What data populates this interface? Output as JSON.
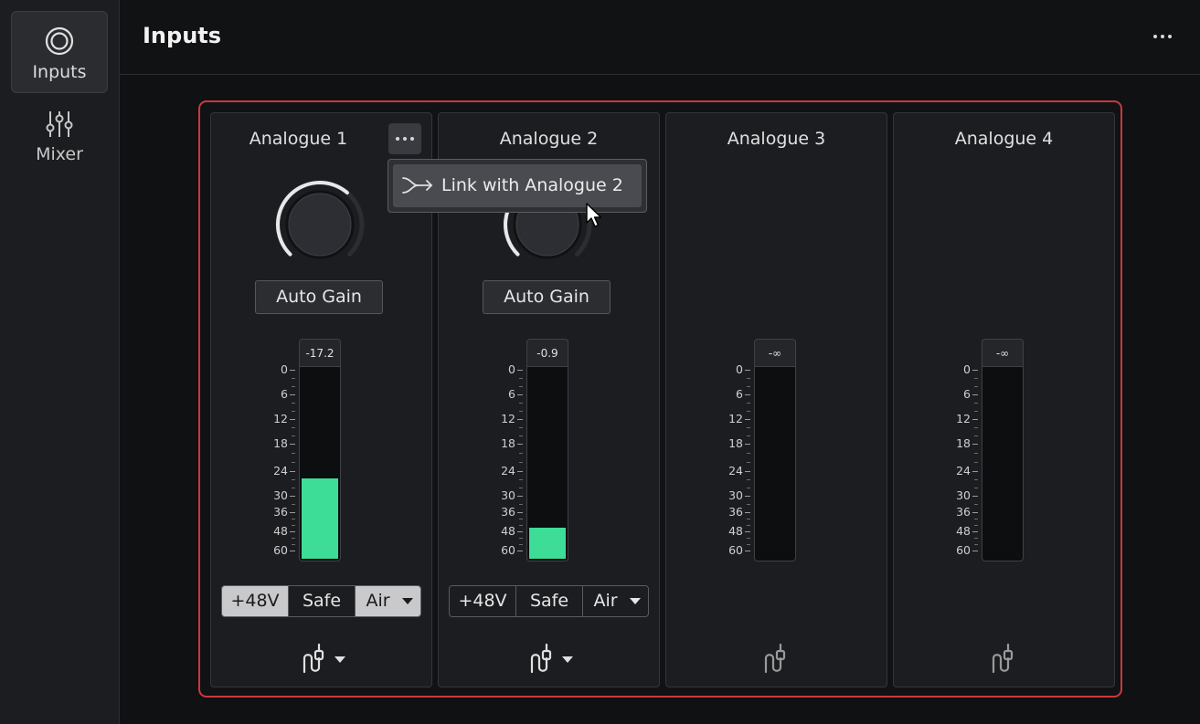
{
  "sidebar": {
    "items": [
      {
        "label": "Inputs",
        "icon": "inputs-icon",
        "active": true
      },
      {
        "label": "Mixer",
        "icon": "mixer-sliders-icon",
        "active": false
      }
    ]
  },
  "header": {
    "title": "Inputs",
    "menu_icon": "more-horizontal-icon"
  },
  "colors": {
    "accent_border": "#c9393d",
    "meter_fill": "#3ddc97",
    "button_on": "#c9c9cc"
  },
  "meter_scale": [
    "0",
    "6",
    "12",
    "18",
    "24",
    "30",
    "36",
    "48",
    "60"
  ],
  "channels": [
    {
      "name": "Analogue 1",
      "has_menu": true,
      "has_controls": true,
      "auto_gain_label": "Auto Gain",
      "knob_level": 0.65,
      "meter_readout": "-17.2",
      "meter_fill": 0.42,
      "buttons": {
        "phantom": "+48V",
        "safe": "Safe",
        "air": "Air"
      },
      "phantom_on": true,
      "safe_on": false,
      "air_on": true,
      "input_type_dropdown": true
    },
    {
      "name": "Analogue 2",
      "has_menu": false,
      "has_controls": true,
      "auto_gain_label": "Auto Gain",
      "knob_level": 0.75,
      "meter_readout": "-0.9",
      "meter_fill": 0.16,
      "buttons": {
        "phantom": "+48V",
        "safe": "Safe",
        "air": "Air"
      },
      "phantom_on": false,
      "safe_on": false,
      "air_on": false,
      "input_type_dropdown": true
    },
    {
      "name": "Analogue 3",
      "has_menu": false,
      "has_controls": false,
      "meter_readout": "-∞",
      "meter_fill": 0,
      "input_type_dropdown": false
    },
    {
      "name": "Analogue 4",
      "has_menu": false,
      "has_controls": false,
      "meter_readout": "-∞",
      "meter_fill": 0,
      "input_type_dropdown": false
    }
  ],
  "context_menu": {
    "item_label": "Link with Analogue 2",
    "item_icon": "link-merge-icon"
  },
  "cursor": "mouse-pointer-icon"
}
